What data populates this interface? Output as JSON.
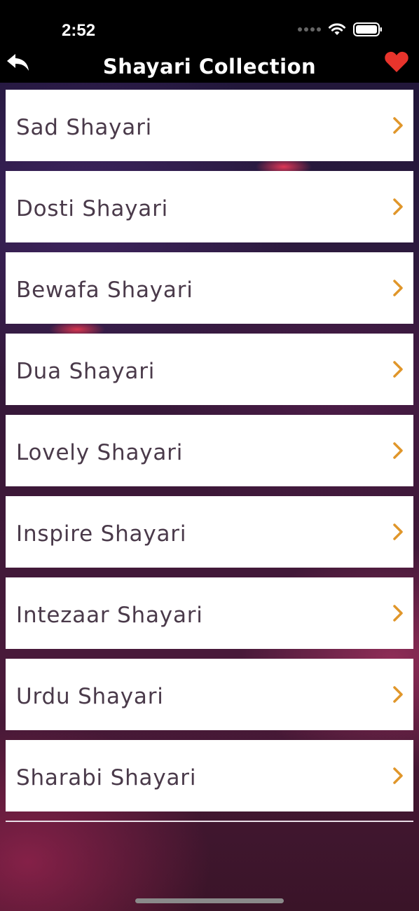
{
  "status_bar": {
    "time": "2:52",
    "icons": [
      "cellular-dots-icon",
      "wifi-icon",
      "battery-icon"
    ]
  },
  "nav": {
    "title": "Shayari Collection",
    "back_icon": "reply-arrow-icon",
    "favorite_icon": "heart-icon"
  },
  "colors": {
    "nav_background": "#000000",
    "item_text": "#4a3a4a",
    "chevron": "#e0962a",
    "heart": "#e8342c"
  },
  "categories": [
    {
      "label": "Sad Shayari"
    },
    {
      "label": "Dosti Shayari"
    },
    {
      "label": "Bewafa Shayari"
    },
    {
      "label": "Dua Shayari"
    },
    {
      "label": "Lovely Shayari"
    },
    {
      "label": "Inspire Shayari"
    },
    {
      "label": "Intezaar Shayari"
    },
    {
      "label": "Urdu Shayari"
    },
    {
      "label": "Sharabi Shayari"
    }
  ]
}
